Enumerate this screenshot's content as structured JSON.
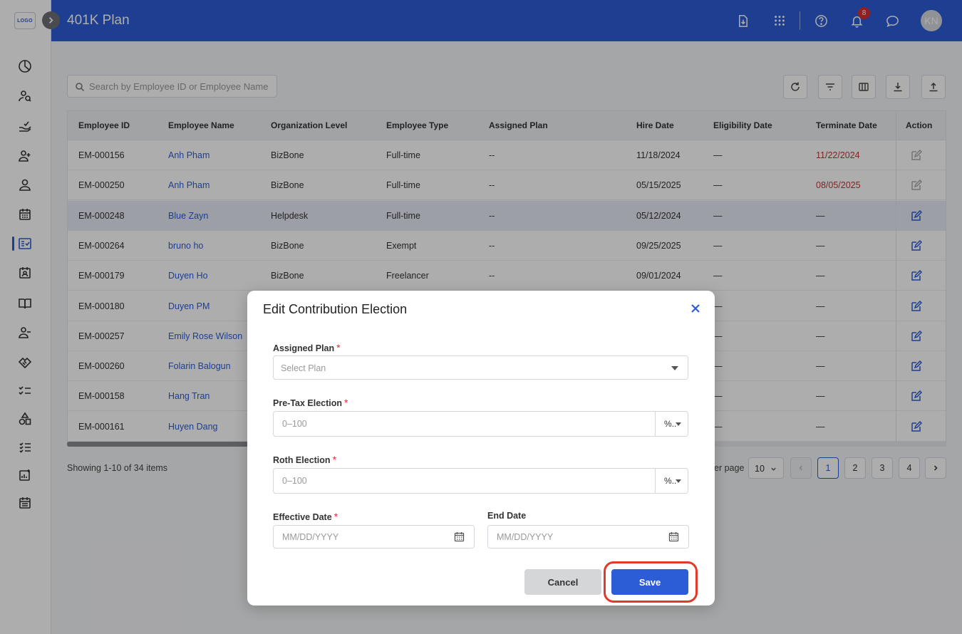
{
  "app": {
    "logo_text": "LOGO"
  },
  "header": {
    "title": "401K Plan",
    "notification_count": "8",
    "avatar_initials": "KN"
  },
  "toolbar": {
    "search_placeholder": "Search by Employee ID or Employee Name"
  },
  "table": {
    "headers": {
      "employee_id": "Employee ID",
      "employee_name": "Employee Name",
      "org_level": "Organization Level",
      "employee_type": "Employee Type",
      "assigned_plan": "Assigned Plan",
      "hire_date": "Hire Date",
      "eligibility_date": "Eligibility Date",
      "terminate_date": "Terminate Date",
      "action": "Action"
    },
    "rows": [
      {
        "id": "EM-000156",
        "name": "Anh Pham",
        "org": "BizBone",
        "type": "Full-time",
        "plan": "--",
        "hire": "11/18/2024",
        "elig": "—",
        "term": "11/22/2024"
      },
      {
        "id": "EM-000250",
        "name": "Anh Pham",
        "org": "BizBone",
        "type": "Full-time",
        "plan": "--",
        "hire": "05/15/2025",
        "elig": "—",
        "term": "08/05/2025"
      },
      {
        "id": "EM-000248",
        "name": "Blue Zayn",
        "org": "Helpdesk",
        "type": "Full-time",
        "plan": "--",
        "hire": "05/12/2024",
        "elig": "—",
        "term": "—"
      },
      {
        "id": "EM-000264",
        "name": "bruno ho",
        "org": "BizBone",
        "type": "Exempt",
        "plan": "--",
        "hire": "09/25/2025",
        "elig": "—",
        "term": "—"
      },
      {
        "id": "EM-000179",
        "name": "Duyen Ho",
        "org": "BizBone",
        "type": "Freelancer",
        "plan": "--",
        "hire": "09/01/2024",
        "elig": "—",
        "term": "—"
      },
      {
        "id": "EM-000180",
        "name": "Duyen PM",
        "org": "",
        "type": "",
        "plan": "",
        "hire": "",
        "elig": "—",
        "term": "—"
      },
      {
        "id": "EM-000257",
        "name": "Emily Rose Wilson",
        "org": "",
        "type": "",
        "plan": "",
        "hire": "",
        "elig": "—",
        "term": "—"
      },
      {
        "id": "EM-000260",
        "name": "Folarin Balogun",
        "org": "",
        "type": "",
        "plan": "",
        "hire": "",
        "elig": "—",
        "term": "—"
      },
      {
        "id": "EM-000158",
        "name": "Hang Tran",
        "org": "",
        "type": "",
        "plan": "",
        "hire": "",
        "elig": "—",
        "term": "—"
      },
      {
        "id": "EM-000161",
        "name": "Huyen Dang",
        "org": "",
        "type": "",
        "plan": "",
        "hire": "",
        "elig": "—",
        "term": "—"
      }
    ]
  },
  "pagination": {
    "showing": "Showing 1-10 of 34 items",
    "per_page_label": "er page",
    "per_page_value": "10",
    "pages": [
      "1",
      "2",
      "3",
      "4"
    ]
  },
  "modal": {
    "title": "Edit Contribution Election",
    "assigned_plan_label": "Assigned Plan",
    "assigned_plan_placeholder": "Select Plan",
    "pretax_label": "Pre-Tax Election",
    "pretax_placeholder": "0–100",
    "pretax_unit": "%..",
    "roth_label": "Roth Election",
    "roth_placeholder": "0–100",
    "roth_unit": "%..",
    "effective_label": "Effective Date",
    "effective_placeholder": "MM/DD/YYYY",
    "end_label": "End Date",
    "end_placeholder": "MM/DD/YYYY",
    "required_mark": "*",
    "cancel_label": "Cancel",
    "save_label": "Save"
  },
  "colors": {
    "primary": "#2c5cd6",
    "danger": "#c03434",
    "highlight_ring": "#e23a28"
  }
}
